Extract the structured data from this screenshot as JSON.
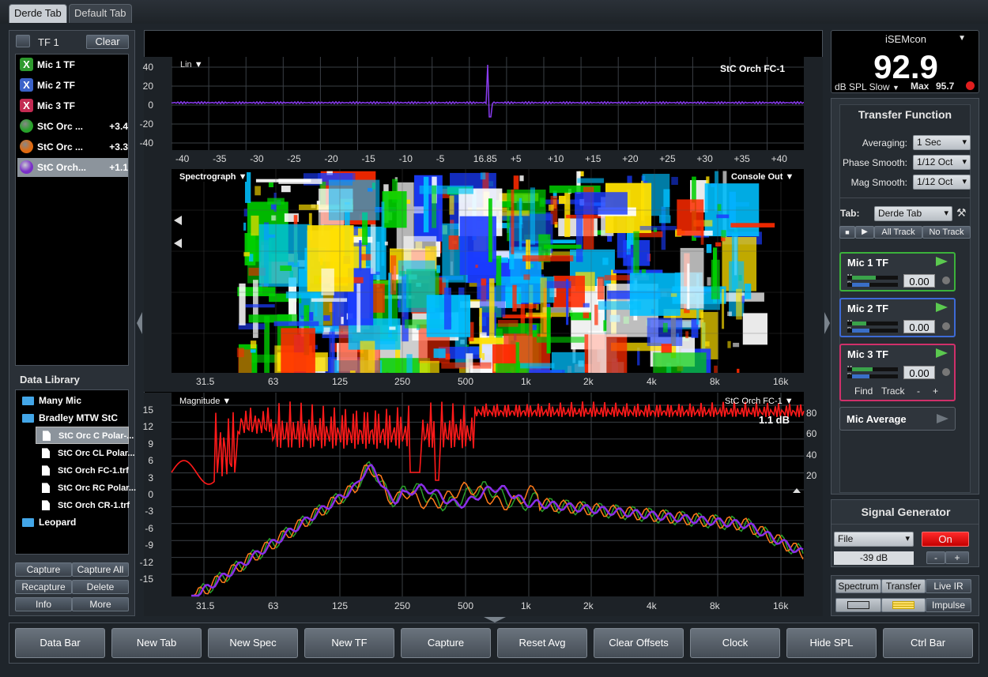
{
  "tabs": [
    "Derde Tab",
    "Default Tab"
  ],
  "left_panel": {
    "tf_label": "TF 1",
    "clear": "Clear",
    "measurements": [
      {
        "label": "Mic 1 TF",
        "value": "",
        "icon": "x-green-icon",
        "color": "#2e9a2e"
      },
      {
        "label": "Mic 2 TF",
        "value": "",
        "icon": "x-blue-icon",
        "color": "#3b62c9"
      },
      {
        "label": "Mic 3 TF",
        "value": "",
        "icon": "x-red-icon",
        "color": "#c32a52"
      },
      {
        "label": "StC Orc ...",
        "value": "+3.4",
        "icon": "green-dot-icon",
        "color": "#27a12a"
      },
      {
        "label": "StC Orc ...",
        "value": "+3.3",
        "icon": "orange-dot-icon",
        "color": "#e06a10"
      },
      {
        "label": "StC Orch...",
        "value": "+1.1",
        "icon": "purple-dot-icon",
        "color": "#7a2fc8"
      }
    ],
    "data_library_title": "Data Library",
    "library": [
      {
        "label": "Many Mic",
        "type": "folder"
      },
      {
        "label": "Bradley MTW StC",
        "type": "folder"
      },
      {
        "label": "StC Orc C Polar-...",
        "type": "file"
      },
      {
        "label": "StC Orc CL Polar...",
        "type": "file"
      },
      {
        "label": "StC Orch FC-1.trf",
        "type": "file"
      },
      {
        "label": "StC Orc RC Polar...",
        "type": "file"
      },
      {
        "label": "StC Orch CR-1.trf",
        "type": "file"
      },
      {
        "label": "Leopard",
        "type": "folder"
      }
    ],
    "buttons": [
      "Capture",
      "Capture All",
      "Recapture",
      "Delete",
      "Info",
      "More"
    ]
  },
  "impulse": {
    "mode": "Lin",
    "trace": "StC Orch FC-1",
    "y_ticks": [
      "40",
      "20",
      "0",
      "-20",
      "-40"
    ],
    "x_ticks": [
      "-40",
      "-35",
      "-30",
      "-25",
      "-20",
      "-15",
      "-10",
      "-5",
      "16.85",
      "+5",
      "+10",
      "+15",
      "+20",
      "+25",
      "+30",
      "+35",
      "+40"
    ]
  },
  "spectrograph": {
    "title": "Spectrograph",
    "source": "Console Out",
    "freq_ticks": [
      "31.5",
      "63",
      "125",
      "250",
      "500",
      "1k",
      "2k",
      "4k",
      "8k",
      "16k"
    ]
  },
  "magnitude": {
    "title": "Magnitude",
    "trace": "StC Orch FC-1",
    "offset": "1.1 dB",
    "y_ticks": [
      "15",
      "12",
      "9",
      "6",
      "3",
      "0",
      "-3",
      "-6",
      "-9",
      "-12",
      "-15"
    ],
    "coh_ticks": [
      "80",
      "60",
      "40",
      "20"
    ],
    "freq_ticks": [
      "31.5",
      "63",
      "125",
      "250",
      "500",
      "1k",
      "2k",
      "4k",
      "8k",
      "16k"
    ]
  },
  "spl": {
    "source": "iSEMcon",
    "value": "92.9",
    "mode": "dB SPL Slow",
    "max_label": "Max",
    "max_value": "95.7"
  },
  "transfer": {
    "title": "Transfer Function",
    "averaging_label": "Averaging:",
    "averaging": "1 Sec",
    "phase_label": "Phase Smooth:",
    "phase": "1/12 Oct",
    "mag_label": "Mag Smooth:",
    "mag": "1/12 Oct",
    "tab_label": "Tab:",
    "tab": "Derde Tab",
    "all_track": "All Track",
    "no_track": "No Track",
    "mics": [
      {
        "name": "Mic 1 TF",
        "value": "0.00",
        "color": "#3bb23b"
      },
      {
        "name": "Mic 2 TF",
        "value": "0.00",
        "color": "#3d6ad6"
      },
      {
        "name": "Mic 3 TF",
        "value": "0.00",
        "color": "#d0306a"
      }
    ],
    "find": "Find",
    "track": "Track",
    "minus": "-",
    "plus": "+",
    "mic_average": "Mic Average"
  },
  "signal_generator": {
    "title": "Signal Generator",
    "source": "File",
    "on": "On",
    "level": "-39 dB",
    "minus": "-",
    "plus": "+"
  },
  "view_buttons": [
    "Spectrum",
    "Transfer",
    "Live IR",
    "Impulse"
  ],
  "bottom_bar": [
    "Data Bar",
    "New Tab",
    "New Spec",
    "New TF",
    "Capture",
    "Reset Avg",
    "Clear Offsets",
    "Clock",
    "Hide SPL",
    "Ctrl Bar"
  ]
}
